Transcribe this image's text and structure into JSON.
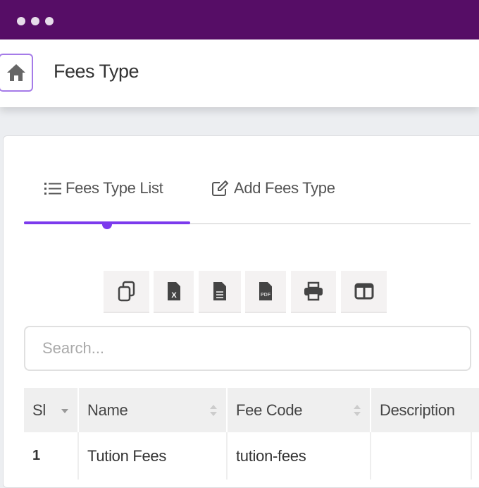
{
  "window": {
    "controls": [
      "dot",
      "dot",
      "dot"
    ]
  },
  "header": {
    "title": "Fees Type",
    "home_icon": "home-icon"
  },
  "tabs": [
    {
      "label": "Fees Type List",
      "icon": "list-icon",
      "active": true
    },
    {
      "label": "Add Fees Type",
      "icon": "edit-icon",
      "active": false
    }
  ],
  "toolbar": [
    "copy-icon",
    "excel-icon",
    "csv-icon",
    "pdf-icon",
    "print-icon",
    "columns-icon"
  ],
  "search": {
    "placeholder": "Search...",
    "value": ""
  },
  "table": {
    "columns": [
      "Sl",
      "Name",
      "Fee Code",
      "Description"
    ],
    "rows": [
      {
        "sl": "1",
        "name": "Tution Fees",
        "code": "tution-fees",
        "description": ""
      }
    ]
  },
  "colors": {
    "topbar": "#560d66",
    "accent": "#7c3aed"
  }
}
